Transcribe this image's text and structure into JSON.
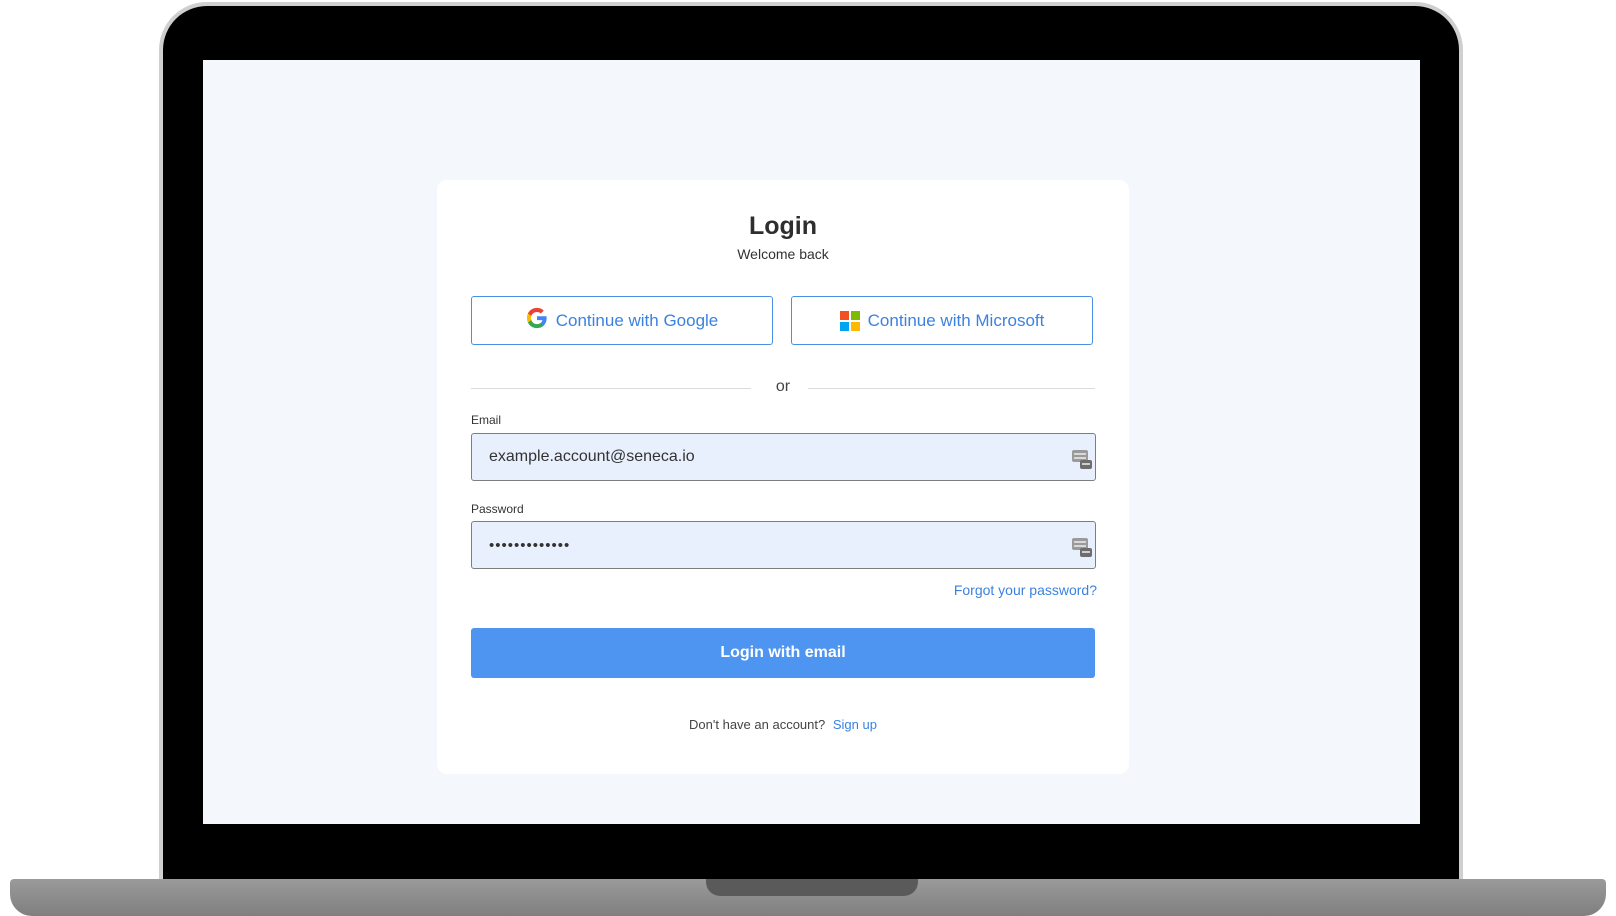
{
  "login": {
    "title": "Login",
    "subtitle": "Welcome back",
    "google_button": "Continue with Google",
    "microsoft_button": "Continue with Microsoft",
    "divider": "or",
    "email_label": "Email",
    "email_value": "example.account@seneca.io",
    "password_label": "Password",
    "password_value": "aaaaaaaaaaaaa",
    "forgot_password": "Forgot your password?",
    "submit_button": "Login with email",
    "signup_prompt": "Don't have an account?",
    "signup_link": "Sign up"
  },
  "icons": {
    "google": "google-logo-icon",
    "microsoft": "microsoft-logo-icon",
    "autofill": "password-manager-icon"
  },
  "colors": {
    "accent": "#4d95f1",
    "link": "#3b82e0",
    "screen_background": "#f4f8fd",
    "field_background": "#e9f0fd",
    "ms_red": "#f25022",
    "ms_green": "#7fba00",
    "ms_blue": "#00a4ef",
    "ms_yellow": "#ffb900"
  }
}
